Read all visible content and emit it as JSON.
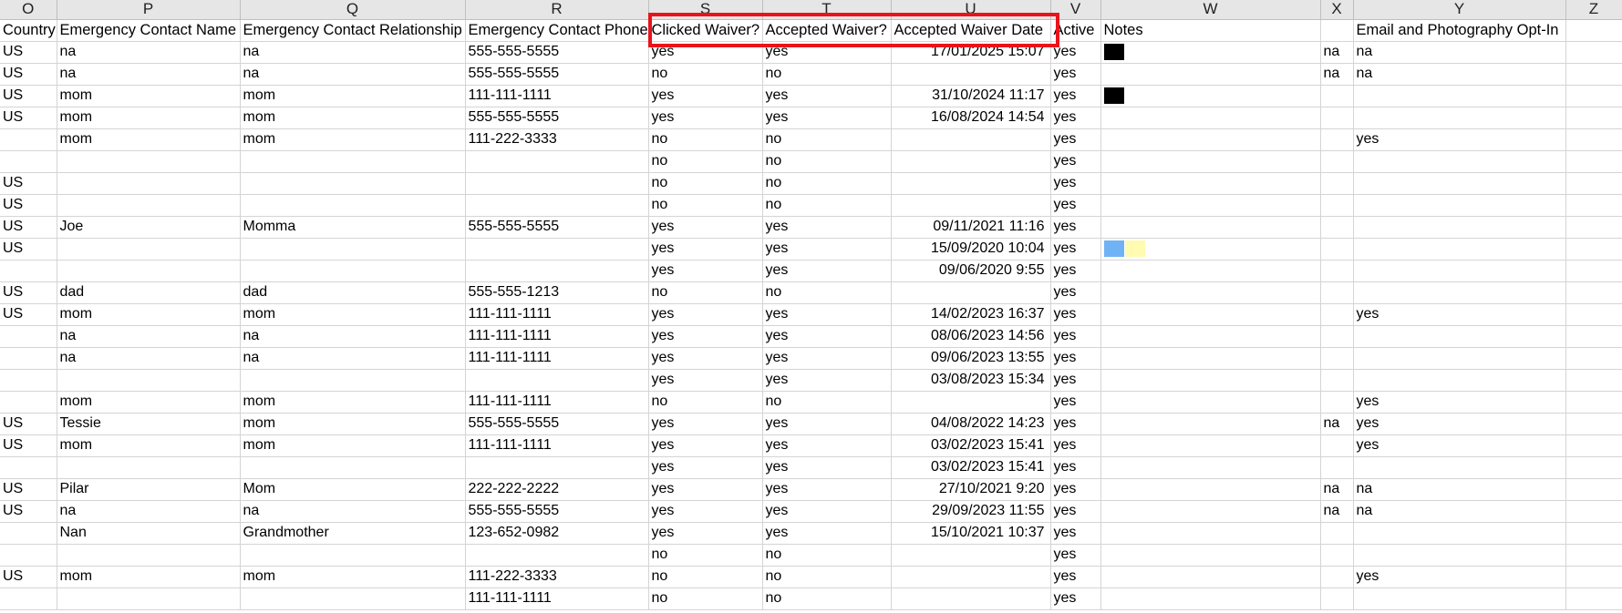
{
  "column_letters": [
    "O",
    "P",
    "Q",
    "R",
    "S",
    "T",
    "U",
    "V",
    "W",
    "X",
    "Y",
    "Z"
  ],
  "header_row": [
    "Country",
    "Emergency Contact Name",
    "Emergency Contact Relationship",
    "Emergency Contact Phone",
    "Clicked Waiver?",
    "Accepted Waiver?",
    "Accepted Waiver Date",
    "Active",
    "Notes",
    "",
    "Email and Photography Opt-In",
    ""
  ],
  "colors": {
    "highlight": "#e8141c",
    "black": "#000000",
    "blue": "#6fb3f5",
    "yellow": "#fffbb0",
    "grid": "#d4d4d4",
    "column_header_bg": "#e6e6e6"
  },
  "rows": [
    {
      "cells": [
        "US",
        "na",
        "na",
        "555-555-5555",
        "yes",
        "yes",
        "17/01/2025 15:07",
        "yes",
        "",
        "na",
        "na",
        ""
      ],
      "swatches": [
        "black"
      ]
    },
    {
      "cells": [
        "US",
        "na",
        "na",
        "555-555-5555",
        "no",
        "no",
        "",
        "yes",
        "",
        "na",
        "na",
        ""
      ],
      "swatches": []
    },
    {
      "cells": [
        "US",
        "mom",
        "mom",
        "111-111-1111",
        "yes",
        "yes",
        "31/10/2024 11:17",
        "yes",
        "",
        "",
        "",
        ""
      ],
      "swatches": [
        "black"
      ]
    },
    {
      "cells": [
        "US",
        "mom",
        "mom",
        "555-555-5555",
        "yes",
        "yes",
        "16/08/2024 14:54",
        "yes",
        "",
        "",
        "",
        ""
      ],
      "swatches": []
    },
    {
      "cells": [
        "",
        "mom",
        "mom",
        "111-222-3333",
        "no",
        "no",
        "",
        "yes",
        "",
        "",
        "yes",
        ""
      ],
      "swatches": []
    },
    {
      "cells": [
        "",
        "",
        "",
        "",
        "no",
        "no",
        "",
        "yes",
        "",
        "",
        "",
        ""
      ],
      "swatches": []
    },
    {
      "cells": [
        "US",
        "",
        "",
        "",
        "no",
        "no",
        "",
        "yes",
        "",
        "",
        "",
        ""
      ],
      "swatches": []
    },
    {
      "cells": [
        "US",
        "",
        "",
        "",
        "no",
        "no",
        "",
        "yes",
        "",
        "",
        "",
        ""
      ],
      "swatches": []
    },
    {
      "cells": [
        "US",
        "Joe",
        "Momma",
        "555-555-5555",
        "yes",
        "yes",
        "09/11/2021 11:16",
        "yes",
        "",
        "",
        "",
        ""
      ],
      "swatches": []
    },
    {
      "cells": [
        "US",
        "",
        "",
        "",
        "yes",
        "yes",
        "15/09/2020 10:04",
        "yes",
        "",
        "",
        "",
        ""
      ],
      "swatches": [
        "blue",
        "yellow"
      ]
    },
    {
      "cells": [
        "",
        "",
        "",
        "",
        "yes",
        "yes",
        "09/06/2020 9:55",
        "yes",
        "",
        "",
        "",
        ""
      ],
      "swatches": []
    },
    {
      "cells": [
        "US",
        "dad",
        "dad",
        "555-555-1213",
        "no",
        "no",
        "",
        "yes",
        "",
        "",
        "",
        ""
      ],
      "swatches": []
    },
    {
      "cells": [
        "US",
        "mom",
        "mom",
        "111-111-1111",
        "yes",
        "yes",
        "14/02/2023 16:37",
        "yes",
        "",
        "",
        "yes",
        ""
      ],
      "swatches": []
    },
    {
      "cells": [
        "",
        "na",
        "na",
        "111-111-1111",
        "yes",
        "yes",
        "08/06/2023 14:56",
        "yes",
        "",
        "",
        "",
        ""
      ],
      "swatches": []
    },
    {
      "cells": [
        "",
        "na",
        "na",
        "111-111-1111",
        "yes",
        "yes",
        "09/06/2023 13:55",
        "yes",
        "",
        "",
        "",
        ""
      ],
      "swatches": []
    },
    {
      "cells": [
        "",
        "",
        "",
        "",
        "yes",
        "yes",
        "03/08/2023 15:34",
        "yes",
        "",
        "",
        "",
        ""
      ],
      "swatches": []
    },
    {
      "cells": [
        "",
        "mom",
        "mom",
        "111-111-1111",
        "no",
        "no",
        "",
        "yes",
        "",
        "",
        "yes",
        ""
      ],
      "swatches": []
    },
    {
      "cells": [
        "US",
        "Tessie",
        "mom",
        "555-555-5555",
        "yes",
        "yes",
        "04/08/2022 14:23",
        "yes",
        "",
        "na",
        "yes",
        ""
      ],
      "swatches": []
    },
    {
      "cells": [
        "US",
        "mom",
        "mom",
        "111-111-1111",
        "yes",
        "yes",
        "03/02/2023 15:41",
        "yes",
        "",
        "",
        "yes",
        ""
      ],
      "swatches": []
    },
    {
      "cells": [
        "",
        "",
        "",
        "",
        "yes",
        "yes",
        "03/02/2023 15:41",
        "yes",
        "",
        "",
        "",
        ""
      ],
      "swatches": []
    },
    {
      "cells": [
        "US",
        "Pilar",
        "Mom",
        "222-222-2222",
        "yes",
        "yes",
        "27/10/2021 9:20",
        "yes",
        "",
        "na",
        "na",
        ""
      ],
      "swatches": []
    },
    {
      "cells": [
        "US",
        "na",
        "na",
        "555-555-5555",
        "yes",
        "yes",
        "29/09/2023 11:55",
        "yes",
        "",
        "na",
        "na",
        ""
      ],
      "swatches": []
    },
    {
      "cells": [
        "",
        "Nan",
        "Grandmother",
        "123-652-0982",
        "yes",
        "yes",
        "15/10/2021 10:37",
        "yes",
        "",
        "",
        "",
        ""
      ],
      "swatches": []
    },
    {
      "cells": [
        "",
        "",
        "",
        "",
        "no",
        "no",
        "",
        "yes",
        "",
        "",
        "",
        ""
      ],
      "swatches": []
    },
    {
      "cells": [
        "US",
        "mom",
        "mom",
        "111-222-3333",
        "no",
        "no",
        "",
        "yes",
        "",
        "",
        "yes",
        ""
      ],
      "swatches": []
    },
    {
      "cells": [
        "",
        "",
        "",
        "111-111-1111",
        "no",
        "no",
        "",
        "yes",
        "",
        "",
        "",
        ""
      ],
      "swatches": []
    }
  ]
}
